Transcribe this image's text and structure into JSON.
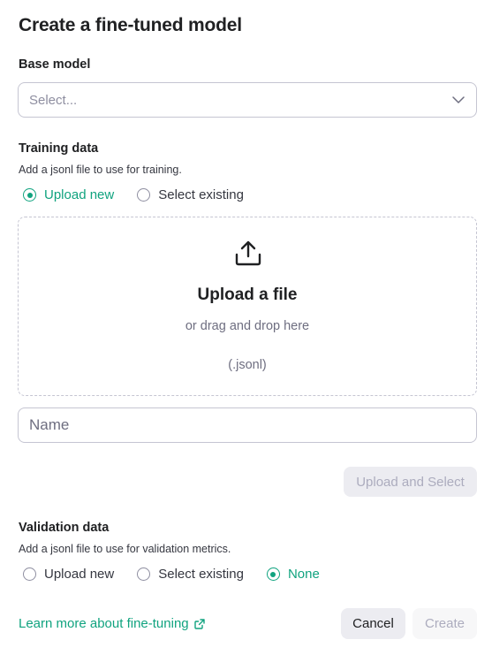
{
  "title": "Create a fine-tuned model",
  "base_model": {
    "label": "Base model",
    "placeholder": "Select..."
  },
  "training": {
    "label": "Training data",
    "hint": "Add a jsonl file to use for training.",
    "options": [
      "Upload new",
      "Select existing"
    ],
    "selected": "Upload new",
    "dropzone": {
      "icon": "upload-icon",
      "title": "Upload a file",
      "subtitle": "or drag and drop here",
      "extension": "(.jsonl)"
    },
    "name_placeholder": "Name",
    "upload_button": "Upload and Select"
  },
  "validation": {
    "label": "Validation data",
    "hint": "Add a jsonl file to use for validation metrics.",
    "options": [
      "Upload new",
      "Select existing",
      "None"
    ],
    "selected": "None"
  },
  "footer": {
    "learn_more": "Learn more about fine-tuning",
    "cancel": "Cancel",
    "create": "Create"
  },
  "colors": {
    "accent": "#10a37f",
    "text": "#202123",
    "border": "#c5c5d2",
    "disabled_text": "#acacbe",
    "button_bg": "#ececf1"
  }
}
